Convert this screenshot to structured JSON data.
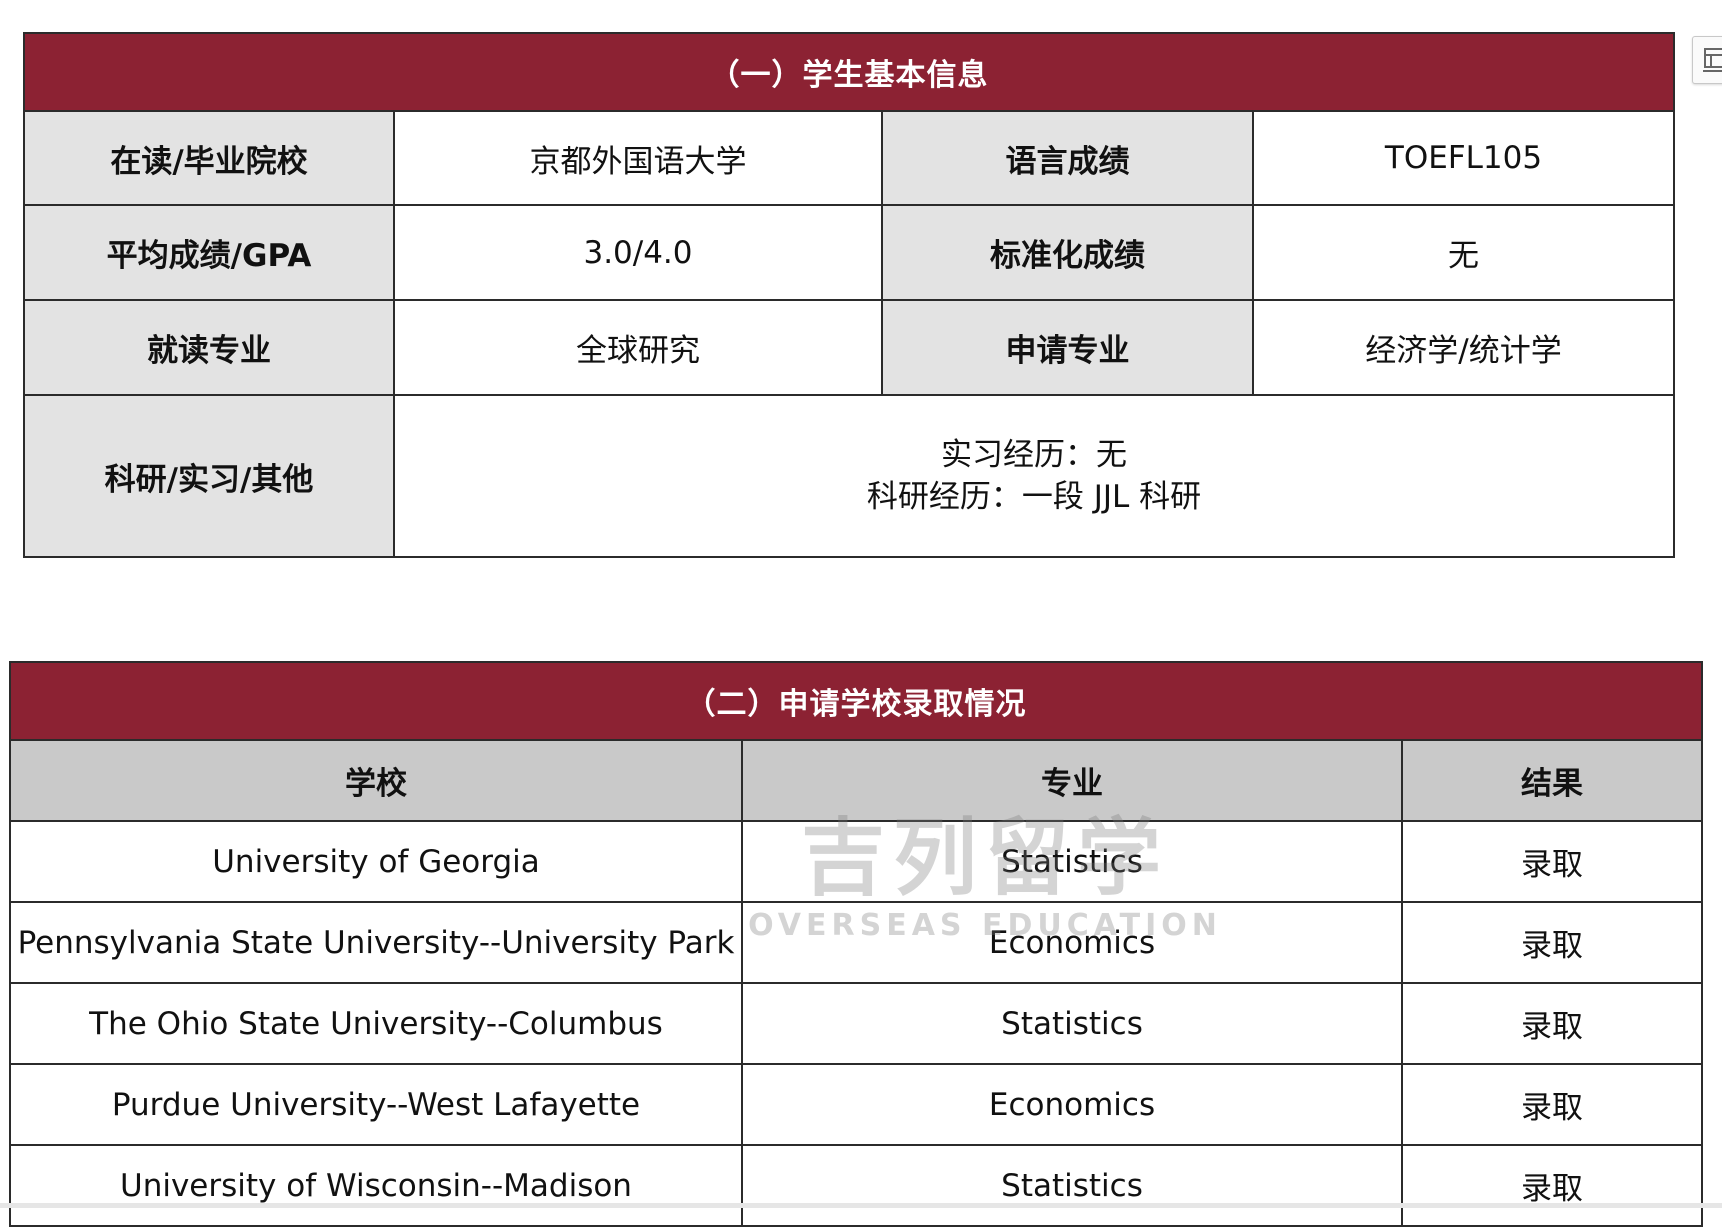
{
  "section1": {
    "title": "（一）学生基本信息",
    "rows": [
      {
        "label1": "在读/毕业院校",
        "value1": "京都外国语大学",
        "label2": "语言成绩",
        "value2": "TOEFL105"
      },
      {
        "label1": "平均成绩/GPA",
        "value1": "3.0/4.0",
        "label2": "标准化成绩",
        "value2": "无"
      },
      {
        "label1": "就读专业",
        "value1": "全球研究",
        "label2": "申请专业",
        "value2": "经济学/统计学"
      }
    ],
    "experience": {
      "label": "科研/实习/其他",
      "line1": "实习经历：无",
      "line2": "科研经历：一段 JJL 科研"
    }
  },
  "section2": {
    "title": "（二）申请学校录取情况",
    "headers": {
      "school": "学校",
      "major": "专业",
      "result": "结果"
    },
    "rows": [
      {
        "school": "University of Georgia",
        "major": "Statistics",
        "result": "录取"
      },
      {
        "school": "Pennsylvania State University--University Park",
        "major": "Economics",
        "result": "录取"
      },
      {
        "school": "The Ohio State University--Columbus",
        "major": "Statistics",
        "result": "录取"
      },
      {
        "school": "Purdue University--West Lafayette",
        "major": "Economics",
        "result": "录取"
      },
      {
        "school": "University of Wisconsin--Madison",
        "major": "Statistics",
        "result": "录取"
      }
    ]
  },
  "watermark": {
    "top": "吉列留学",
    "bottom": "OVERSEAS EDUCATION"
  },
  "colors": {
    "header_bg": "#8c2233",
    "label_bg": "#e3e3e3",
    "colhead_bg": "#c9c9c9"
  }
}
